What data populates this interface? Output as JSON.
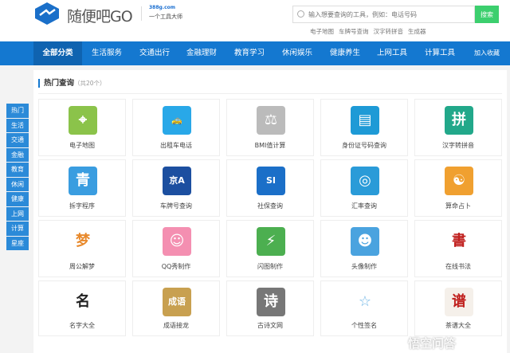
{
  "header": {
    "logo_text": "随便吧GO",
    "domain": "388g.com",
    "slogan": "一个工具大师",
    "search_placeholder": "输入想要查询的工具，例如：电话号码",
    "search_button": "搜索",
    "hot_links": [
      "电子地图",
      "车牌号查询",
      "汉字转拼音",
      "生成器"
    ]
  },
  "nav": {
    "items": [
      "全部分类",
      "生活服务",
      "交通出行",
      "金融理财",
      "教育学习",
      "休闲娱乐",
      "健康养生",
      "上网工具",
      "计算工具",
      "加入收藏"
    ]
  },
  "sidebar": {
    "items": [
      "热门",
      "生活",
      "交通",
      "金融",
      "教育",
      "休闲",
      "健康",
      "上网",
      "计算",
      "星座"
    ]
  },
  "section": {
    "title": "热门查询",
    "count": "（共20个）"
  },
  "tools": [
    {
      "label": "电子地图",
      "icon": "map-icon",
      "glyph": "⌖",
      "color": "#8bc34a"
    },
    {
      "label": "出租车电话",
      "icon": "taxi-icon",
      "glyph": "🚕",
      "color": "#29a8e8"
    },
    {
      "label": "BMI值计算",
      "icon": "scale-icon",
      "glyph": "⚖",
      "color": "#bbbbbb"
    },
    {
      "label": "身份证号码查询",
      "icon": "id-card-icon",
      "glyph": "▤",
      "color": "#1e9ad6"
    },
    {
      "label": "汉字转拼音",
      "icon": "pinyin-icon",
      "glyph": "拼",
      "color": "#22a88a"
    },
    {
      "label": "拆字程序",
      "icon": "split-char-icon",
      "glyph": "青",
      "color": "#3a9de0"
    },
    {
      "label": "车牌号查询",
      "icon": "license-plate-icon",
      "glyph": "京A",
      "color": "#1c4fa0"
    },
    {
      "label": "社保查询",
      "icon": "social-security-icon",
      "glyph": "SI",
      "color": "#1b6fc8"
    },
    {
      "label": "汇率查询",
      "icon": "globe-icon",
      "glyph": "◎",
      "color": "#2a9bd8"
    },
    {
      "label": "算命占卜",
      "icon": "fortune-icon",
      "glyph": "☯",
      "color": "#f0a030"
    },
    {
      "label": "周公解梦",
      "icon": "dream-icon",
      "glyph": "梦",
      "color": "#ffffff"
    },
    {
      "label": "QQ秀制作",
      "icon": "qq-show-icon",
      "glyph": "☺",
      "color": "#f48fb1"
    },
    {
      "label": "闪图制作",
      "icon": "flash-icon",
      "glyph": "⚡",
      "color": "#4caf50"
    },
    {
      "label": "头像制作",
      "icon": "avatar-icon",
      "glyph": "☻",
      "color": "#4aa3df"
    },
    {
      "label": "在线书法",
      "icon": "calligraphy-icon",
      "glyph": "書",
      "color": "#ffffff"
    },
    {
      "label": "名字大全",
      "icon": "name-icon",
      "glyph": "名",
      "color": "#ffffff"
    },
    {
      "label": "成语接龙",
      "icon": "idiom-book-icon",
      "glyph": "成语",
      "color": "#c8a050"
    },
    {
      "label": "古诗文网",
      "icon": "poem-icon",
      "glyph": "诗",
      "color": "#777777"
    },
    {
      "label": "个性签名",
      "icon": "magic-wand-icon",
      "glyph": "☆",
      "color": "#ffffff"
    },
    {
      "label": "茶谱大全",
      "icon": "recipe-icon",
      "glyph": "谱",
      "color": "#f5f0ea"
    }
  ],
  "watermark": "悟空问答"
}
